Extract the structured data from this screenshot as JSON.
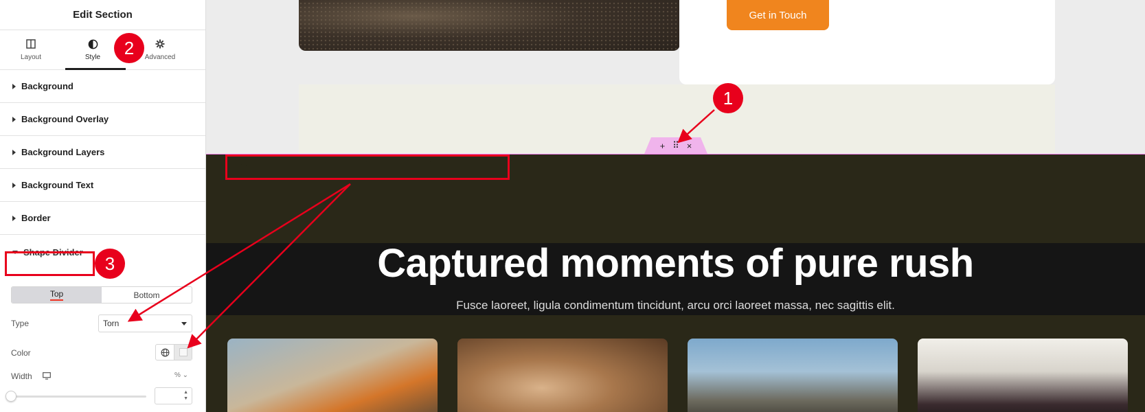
{
  "panel": {
    "title": "Edit Section",
    "tabs": [
      {
        "label": "Layout",
        "icon": "layout-icon"
      },
      {
        "label": "Style",
        "icon": "style-icon"
      },
      {
        "label": "Advanced",
        "icon": "gear-icon"
      }
    ],
    "sections": [
      "Background",
      "Background Overlay",
      "Background Layers",
      "Background Text",
      "Border"
    ],
    "shape_divider": {
      "title": "Shape Divider",
      "toggle": [
        "Top",
        "Bottom"
      ],
      "type_label": "Type",
      "type_value": "Torn",
      "color_label": "Color",
      "width_label": "Width",
      "width_unit": "% ⌄"
    }
  },
  "canvas": {
    "cta_label": "Get in Touch",
    "controls": [
      "+",
      "⠿",
      "×"
    ],
    "headline": "Captured moments of pure rush",
    "subline": "Fusce laoreet, ligula condimentum tincidunt, arcu orci laoreet massa, nec sagittis elit."
  },
  "annotations": {
    "badge_1": "1",
    "badge_2": "2",
    "badge_3": "3"
  },
  "colors": {
    "accent": "#f0851e",
    "annotation": "#e8001c",
    "dark_band": "#2a2818",
    "editor_pink": "#f07ce8"
  }
}
